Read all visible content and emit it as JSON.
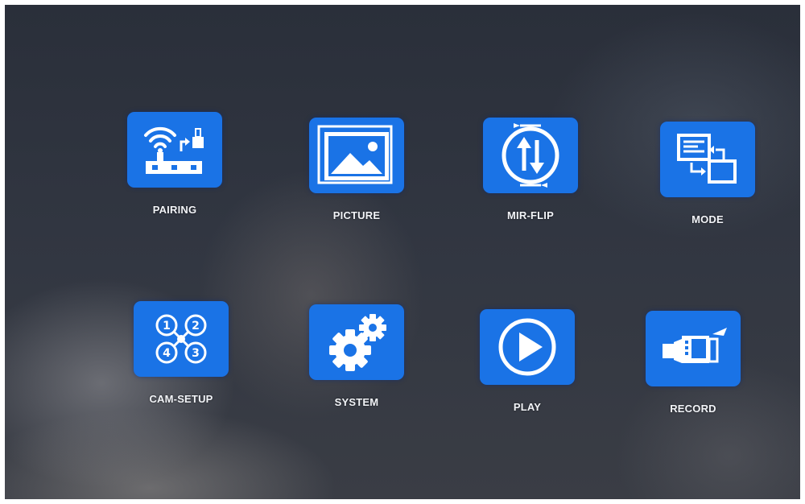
{
  "menu": {
    "items": [
      {
        "label": "PAIRING",
        "icon": "pairing-icon"
      },
      {
        "label": "PICTURE",
        "icon": "picture-icon"
      },
      {
        "label": "MIR-FLIP",
        "icon": "mirror-flip-icon"
      },
      {
        "label": "MODE",
        "icon": "mode-icon"
      },
      {
        "label": "CAM-SETUP",
        "icon": "camera-setup-icon"
      },
      {
        "label": "SYSTEM",
        "icon": "gears-icon"
      },
      {
        "label": "PLAY",
        "icon": "play-icon"
      },
      {
        "label": "RECORD",
        "icon": "video-camera-icon"
      }
    ]
  },
  "colors": {
    "tile_blue": "#1a73e6",
    "label_white": "#f2f4f8",
    "background": "#2f343f"
  }
}
